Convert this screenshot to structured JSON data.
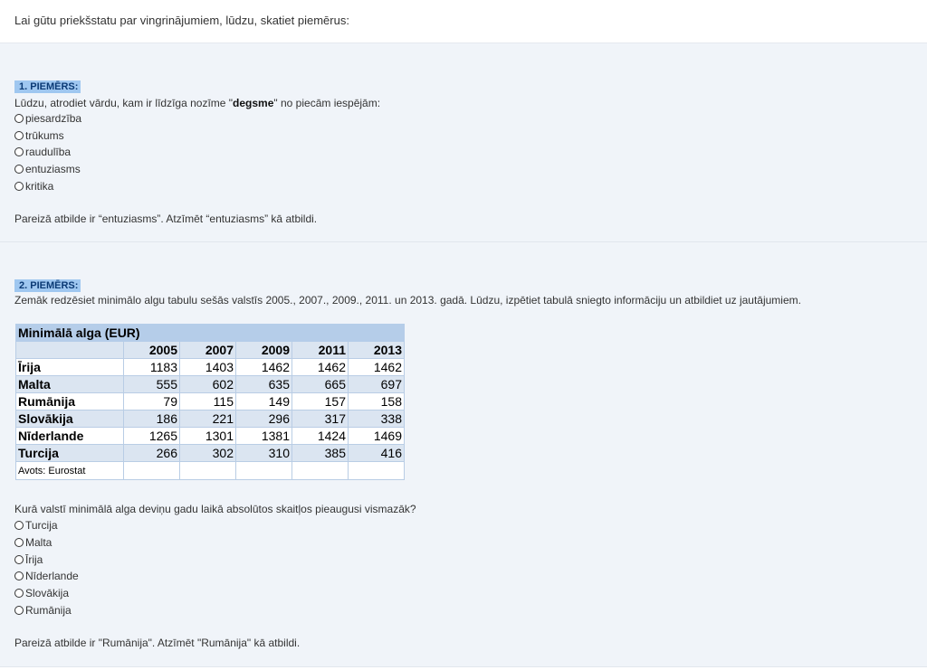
{
  "intro": "Lai gūtu priekšstatu par vingrinājumiem, lūdzu, skatiet piemērus:",
  "example1": {
    "label": "1. PIEMĒRS:",
    "question_before": "Lūdzu, atrodiet vārdu, kam ir līdzīga nozīme \"",
    "keyword": "degsme",
    "question_after": "\" no piecām iespējām:",
    "options": [
      "piesardzība",
      "trūkums",
      "raudulība",
      "entuziasms",
      "kritika"
    ],
    "answer": "Pareizā atbilde ir “entuziasms”. Atzīmēt “entuziasms” kā atbildi."
  },
  "example2": {
    "label": "2. PIEMĒRS:",
    "description": "Zemāk redzēsiet minimālo algu tabulu sešās valstīs 2005., 2007., 2009., 2011. un 2013. gadā. Lūdzu, izpētiet tabulā sniegto informāciju un atbildiet uz jautājumiem.",
    "table": {
      "title": "Minimālā alga (EUR)",
      "years": [
        "2005",
        "2007",
        "2009",
        "2011",
        "2013"
      ],
      "rows": [
        {
          "country": "Īrija",
          "values": [
            "1183",
            "1403",
            "1462",
            "1462",
            "1462"
          ]
        },
        {
          "country": "Malta",
          "values": [
            "555",
            "602",
            "635",
            "665",
            "697"
          ]
        },
        {
          "country": "Rumānija",
          "values": [
            "79",
            "115",
            "149",
            "157",
            "158"
          ]
        },
        {
          "country": "Slovākija",
          "values": [
            "186",
            "221",
            "296",
            "317",
            "338"
          ]
        },
        {
          "country": "Nīderlande",
          "values": [
            "1265",
            "1301",
            "1381",
            "1424",
            "1469"
          ]
        },
        {
          "country": "Turcija",
          "values": [
            "266",
            "302",
            "310",
            "385",
            "416"
          ]
        }
      ],
      "source": "Avots: Eurostat"
    },
    "question": "Kurā valstī minimālā alga deviņu gadu laikā absolūtos skaitļos pieaugusi vismazāk?",
    "options": [
      "Turcija",
      "Malta",
      "Īrija",
      "Nīderlande",
      "Slovākija",
      "Rumānija"
    ],
    "answer": "Pareizā atbilde ir \"Rumānija\". Atzīmēt \"Rumānija\" kā atbildi."
  }
}
